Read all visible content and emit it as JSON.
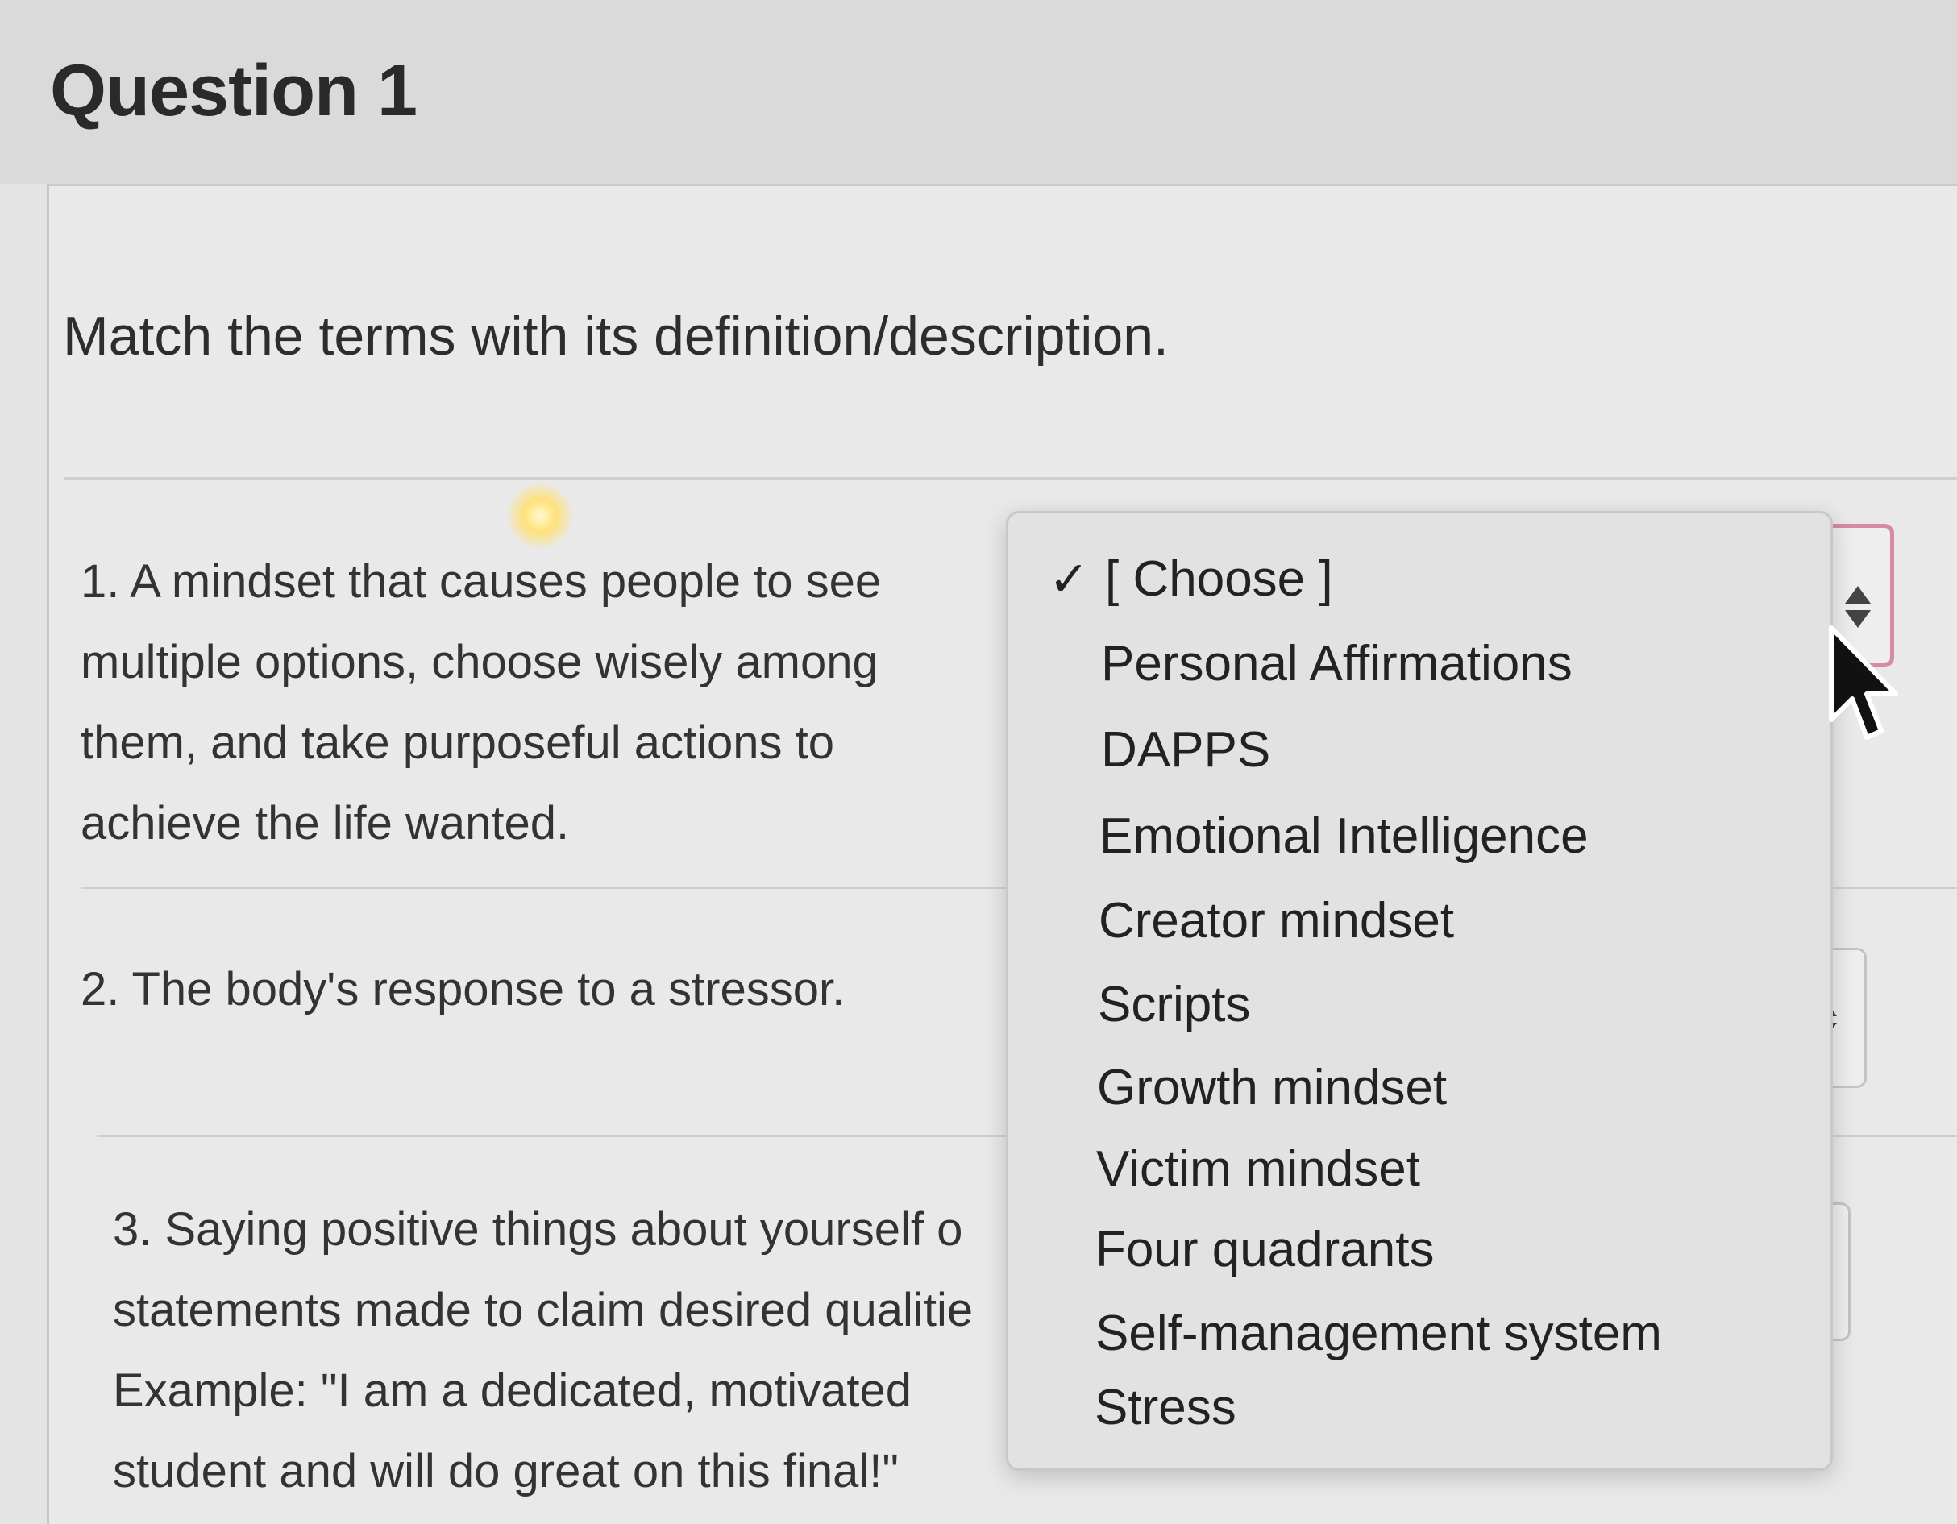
{
  "question": {
    "title": "Question 1",
    "prompt": "Match the terms with its definition/description."
  },
  "matches": [
    {
      "number": "1.",
      "text": "A mindset that causes people to see\nmultiple options, choose wisely among\nthem, and take purposeful actions to\nachieve the life wanted."
    },
    {
      "number": "2.",
      "text": "The body's response to a stressor."
    },
    {
      "number": "3.",
      "text": "Saying positive things about yourself o\nstatements made to claim desired qualitie\nExample: \"I am a dedicated, motivated\nstudent and will do great on this final!\""
    }
  ],
  "dropdown": {
    "selected_index": 0,
    "check_glyph": "✓",
    "options": [
      "[ Choose ]",
      "Personal Affirmations",
      "DAPPS",
      "Emotional Intelligence",
      "Creator mindset",
      "Scripts",
      "Growth mindset",
      "Victim mindset",
      "Four quadrants",
      "Self-management system",
      "Stress"
    ]
  },
  "icons": {
    "select_arrows": "up-down-arrows-icon",
    "cursor": "mouse-pointer-icon"
  },
  "colors": {
    "focus_border": "#d68aa6",
    "header_bg": "#dadada"
  }
}
